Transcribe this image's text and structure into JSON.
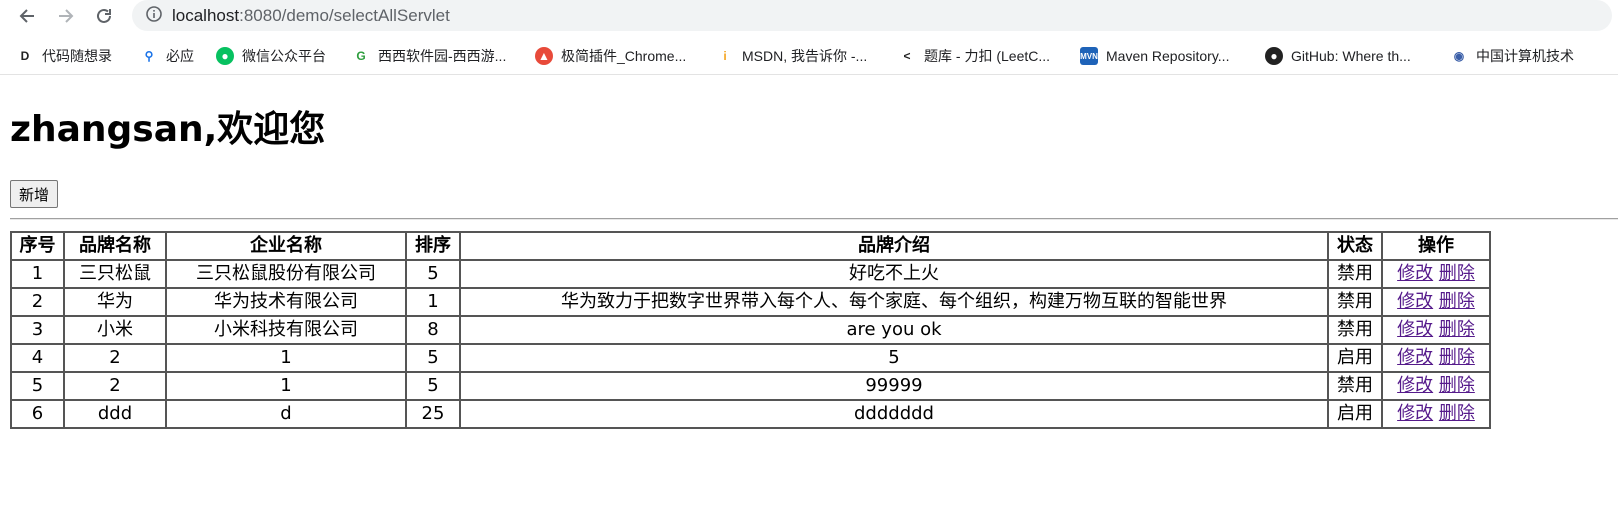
{
  "browser": {
    "url_host": "localhost",
    "url_rest": ":8080/demo/selectAllServlet",
    "bookmarks": [
      {
        "label": "代码随想录",
        "icon": "code-bookmark-icon",
        "icon_color": "#222222"
      },
      {
        "label": "必应",
        "icon": "bing-search-icon",
        "icon_color": "#1a73e8"
      },
      {
        "label": "微信公众平台",
        "icon": "wechat-icon",
        "icon_color": "#07c160"
      },
      {
        "label": "西西软件园-西西游...",
        "icon": "cncrk-icon",
        "icon_color": "#2e9e3e"
      },
      {
        "label": "极简插件_Chrome...",
        "icon": "chrome-plugin-icon",
        "icon_color": "#e84a3a"
      },
      {
        "label": "MSDN, 我告诉你 -...",
        "icon": "msdn-icon",
        "icon_color": "#f5a623"
      },
      {
        "label": "题库 - 力扣 (LeetC...",
        "icon": "leetcode-icon",
        "icon_color": "#222222"
      },
      {
        "label": "Maven Repository...",
        "icon": "maven-icon",
        "icon_color": "#1e63b8"
      },
      {
        "label": "GitHub: Where th...",
        "icon": "github-icon",
        "icon_color": "#222222"
      },
      {
        "label": "中国计算机技术",
        "icon": "cn-computer-icon",
        "icon_color": "#3b5fa8"
      }
    ]
  },
  "page": {
    "title": "zhangsan,欢迎您",
    "add_button_label": "新增"
  },
  "table": {
    "headers": [
      "序号",
      "品牌名称",
      "企业名称",
      "排序",
      "品牌介绍",
      "状态",
      "操作"
    ],
    "edit_label": "修改",
    "delete_label": "删除",
    "rows": [
      {
        "id": "1",
        "brand": "三只松鼠",
        "company": "三只松鼠股份有限公司",
        "order": "5",
        "desc": "好吃不上火",
        "status": "禁用"
      },
      {
        "id": "2",
        "brand": "华为",
        "company": "华为技术有限公司",
        "order": "1",
        "desc": "华为致力于把数字世界带入每个人、每个家庭、每个组织，构建万物互联的智能世界",
        "status": "禁用"
      },
      {
        "id": "3",
        "brand": "小米",
        "company": "小米科技有限公司",
        "order": "8",
        "desc": "are you ok",
        "status": "禁用"
      },
      {
        "id": "4",
        "brand": "2",
        "company": "1",
        "order": "5",
        "desc": "5",
        "status": "启用"
      },
      {
        "id": "5",
        "brand": "2",
        "company": "1",
        "order": "5",
        "desc": "99999",
        "status": "禁用"
      },
      {
        "id": "6",
        "brand": "ddd",
        "company": "d",
        "order": "25",
        "desc": "ddddddd",
        "status": "启用"
      }
    ]
  }
}
